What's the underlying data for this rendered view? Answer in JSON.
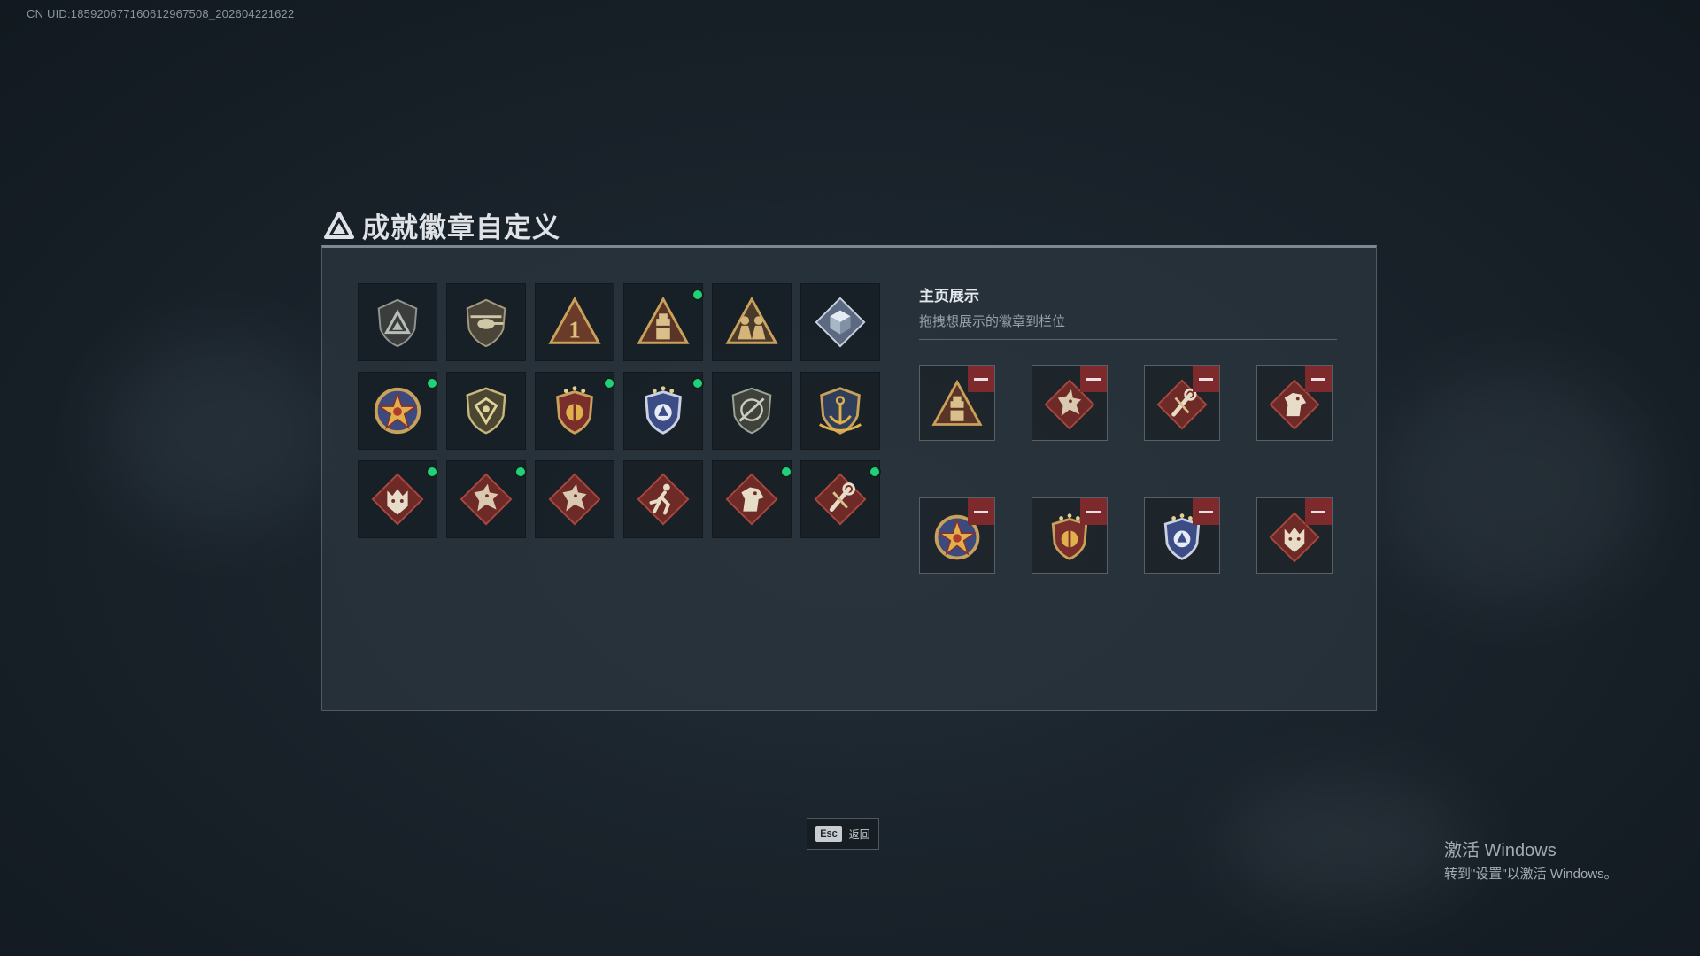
{
  "uid_text": "CN UID:185920677160612967508_202604221622",
  "page": {
    "title": "成就徽章自定义",
    "logo_icon": "triangle-logo-icon"
  },
  "badge_grid": {
    "rows": [
      [
        {
          "icon": "shield-triangle-badge-icon",
          "new": false
        },
        {
          "icon": "helicopter-shield-badge-icon",
          "new": false
        },
        {
          "icon": "triangle-number-one-badge-icon",
          "new": false
        },
        {
          "icon": "triangle-tower-badge-icon",
          "new": true
        },
        {
          "icon": "triangle-soldiers-badge-icon",
          "new": false
        },
        {
          "icon": "silver-diamond-cube-badge-icon",
          "new": false
        }
      ],
      [
        {
          "icon": "gold-star-medal-badge-icon",
          "new": true
        },
        {
          "icon": "gold-shield-crest-badge-icon",
          "new": false
        },
        {
          "icon": "red-shield-stars-badge-icon",
          "new": true
        },
        {
          "icon": "blue-shield-stars-badge-icon",
          "new": true
        },
        {
          "icon": "rifle-shield-badge-icon",
          "new": false
        },
        {
          "icon": "anchor-shield-badge-icon",
          "new": false
        }
      ],
      [
        {
          "icon": "wolf-diamond-badge-icon",
          "new": true
        },
        {
          "icon": "dragon-diamond-badge-icon",
          "new": true
        },
        {
          "icon": "dragon-diamond-badge-icon",
          "new": false
        },
        {
          "icon": "runner-diamond-badge-icon",
          "new": false
        },
        {
          "icon": "horse-diamond-badge-icon",
          "new": true
        },
        {
          "icon": "wrench-diamond-badge-icon",
          "new": true
        }
      ]
    ]
  },
  "showcase": {
    "title": "主页展示",
    "subtitle": "拖拽想展示的徽章到栏位",
    "slots": [
      {
        "icon": "triangle-tower-badge-icon"
      },
      {
        "icon": "dragon-diamond-badge-icon"
      },
      {
        "icon": "wrench-diamond-badge-icon"
      },
      {
        "icon": "horse-diamond-badge-icon"
      },
      {
        "icon": "gold-star-medal-badge-icon"
      },
      {
        "icon": "red-shield-stars-badge-icon"
      },
      {
        "icon": "blue-shield-stars-badge-icon"
      },
      {
        "icon": "wolf-diamond-badge-icon"
      }
    ]
  },
  "footer": {
    "esc_key": "Esc",
    "back_label": "返回"
  },
  "windows_watermark": {
    "line1": "激活 Windows",
    "line2": "转到\"设置\"以激活 Windows。"
  },
  "colors": {
    "new_indicator": "#1fd17a",
    "remove_button": "#7e2a2c",
    "badge_gold": "#c9a15a",
    "badge_red": "#7a2e2b",
    "badge_blue": "#3b4c86",
    "panel_bg": "#2a343e"
  }
}
